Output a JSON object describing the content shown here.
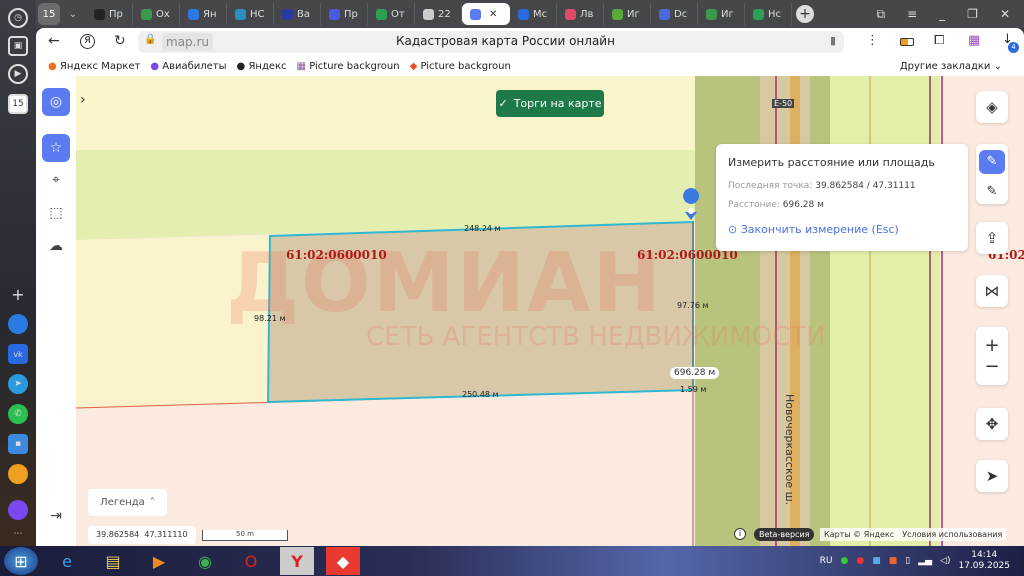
{
  "os_sidebar": {
    "badge": "15"
  },
  "tabs": {
    "group_badge": "15",
    "items": [
      {
        "label": "Пр",
        "color": "#222"
      },
      {
        "label": "Ох",
        "color": "#3a9a4a"
      },
      {
        "label": "Ян",
        "color": "#2a7adf"
      },
      {
        "label": "НС",
        "color": "#2a90c0"
      },
      {
        "label": "Ва",
        "color": "#2a3aa0"
      },
      {
        "label": "Пр",
        "color": "#4a5adf"
      },
      {
        "label": "От",
        "color": "#2aa050"
      },
      {
        "label": "22",
        "color": "#ccc"
      },
      {
        "label": "",
        "color": "#5a7cf0",
        "active": true
      },
      {
        "label": "Мс",
        "color": "#2a6adf"
      },
      {
        "label": "Лв",
        "color": "#e04a6a"
      },
      {
        "label": "Иг",
        "color": "#5aaa3a"
      },
      {
        "label": "Dc",
        "color": "#4a6adf"
      },
      {
        "label": "Иг",
        "color": "#3a9a4a"
      },
      {
        "label": "Нс",
        "color": "#2aa050"
      }
    ]
  },
  "address": {
    "url": "map.ru",
    "title": "Кадастровая карта России онлайн",
    "downloads_badge": "4"
  },
  "bookmarks": {
    "items": [
      "Яндекс Маркет",
      "Авиабилеты",
      "Яндекс",
      "Picture backgroun",
      "Picture backgroun"
    ],
    "other": "Другие закладки"
  },
  "map": {
    "auction_button": "Торги на карте",
    "road_badge": "E-50",
    "parcel_label": "61:02:0600010",
    "parcel_label_right": "61:02:0600010",
    "parcel_label_edge": "61:02",
    "watermark_brand": "ДОМИАН",
    "watermark_tagline": "СЕТЬ АГЕНТСТВ НЕДВИЖИМОСТИ",
    "edge_labels": {
      "top": "248.24 м",
      "left": "98.21 м",
      "right": "97.76 м",
      "bottom": "250.48 м",
      "small": "1.59 м",
      "total": "696.28 м"
    },
    "street": "Новочеркасское ш.",
    "legend_button": "Легенда",
    "coords": "39.862584  47.311110",
    "scale": "50 m",
    "beta": "Beta-версия",
    "attribution": "Карты © Яндекс",
    "terms": "Условия использования"
  },
  "measure_popup": {
    "title": "Измерить расстояние или площадь",
    "last_point_label": "Последняя точка:",
    "last_point_value": "39.862584 / 47.31111",
    "distance_label": "Расстоние:",
    "distance_value": "696.28 м",
    "finish": "Закончить измерение (Esc)"
  },
  "taskbar": {
    "lang": "RU",
    "time": "14:14",
    "date": "17.09.2025"
  }
}
